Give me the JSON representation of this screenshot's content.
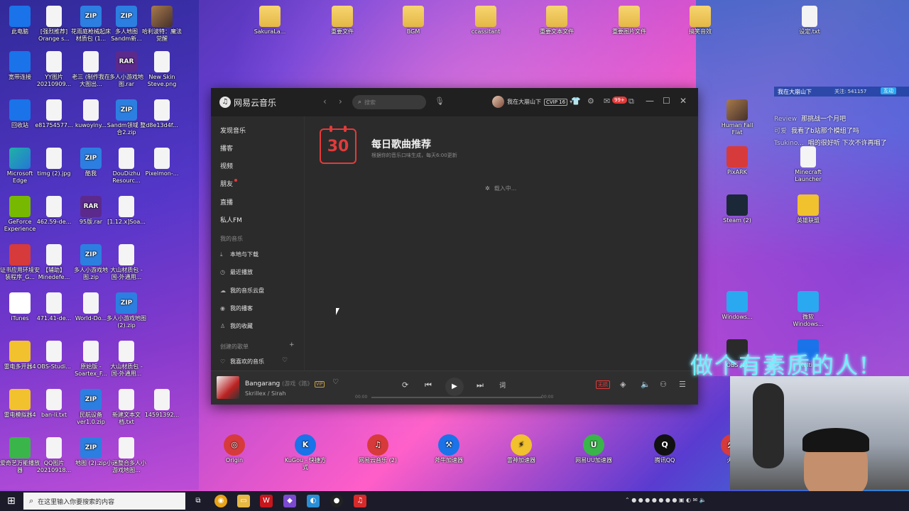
{
  "desktop": {
    "top_row": [
      {
        "label": "此电脑",
        "icon": "computer-icon",
        "cls": "g-blue"
      },
      {
        "label": "[强烈推荐] Orange s...",
        "icon": "file-icon",
        "cls": "g-file"
      },
      {
        "label": "花雨庭枪械起床材质包 (1...",
        "icon": "zip-icon",
        "cls": "g-zip"
      },
      {
        "label": "多人地图 Sandm新...",
        "icon": "zip-icon",
        "cls": "g-zip"
      },
      {
        "label": "哈利波特：魔法觉醒",
        "icon": "game-icon",
        "cls": "g-img"
      },
      {
        "label": "SakuraLa...",
        "icon": "folder-icon",
        "cls": "g-folder"
      },
      {
        "label": "重要文件",
        "icon": "folder-icon",
        "cls": "g-folder"
      },
      {
        "label": "BGM",
        "icon": "folder-icon",
        "cls": "g-folder"
      },
      {
        "label": "ccassitant",
        "icon": "folder-icon",
        "cls": "g-folder"
      },
      {
        "label": "重要文本文件",
        "icon": "folder-icon",
        "cls": "g-folder"
      },
      {
        "label": "重要图片文件",
        "icon": "folder-icon",
        "cls": "g-folder"
      },
      {
        "label": "搞笑音效",
        "icon": "folder-icon",
        "cls": "g-folder"
      },
      {
        "label": "设定.txt",
        "icon": "text-file-icon",
        "cls": "g-file"
      }
    ],
    "left_grid": [
      [
        "宽带连接",
        "YY图片 20210909...",
        "老三 (制作我在大图出...",
        "多人小游戏地图.rar",
        "New Skin Steve.png"
      ],
      [
        "回收站",
        "e81754577...",
        "kuwoyiny...",
        "Sandm领域 整合2.zip",
        "d8e13d4f..."
      ],
      [
        "Microsoft Edge",
        "timg (2).jpg",
        "酷我",
        "DouDizhu Resourc...",
        "Pixelmon-..."
      ],
      [
        "GeForce Experience",
        "462.59-de...",
        "95版.rar",
        "[1.12.x]Soa..."
      ],
      [
        "证书应用环境安装程序_G...",
        "【辅助】Minedefe...",
        "多人小游戏地图.zip",
        "大山材质包 - 国-外通用..."
      ],
      [
        "iTunes",
        "471.41-de...",
        "World-Do...",
        "多人小游戏地图 (2).zip"
      ],
      [
        "雷电多开器4",
        "OBS-Studi...",
        "原始版 - Soartex_F...",
        "大山材质包 - 国-外通用..."
      ],
      [
        "雷电模拟器4",
        "ban-li.txt",
        "民航设备 ver1.0.zip",
        "新建文本文档.txt",
        "14591392..."
      ],
      [
        "爱奇艺万能播放器",
        "QQ图片 20210918...",
        "地图 (2).zip",
        "小迷整合多人小游戏地图..."
      ]
    ],
    "right_col": [
      {
        "label": "Human Fall Flat",
        "cls": "g-img",
        "icon": "game-icon"
      },
      {
        "label": "PixARK",
        "cls": "g-red",
        "icon": "game-icon"
      },
      {
        "label": "Minecraft Launcher",
        "cls": "g-file",
        "icon": "file-icon"
      },
      {
        "label": "Steam (2)",
        "cls": "g-steam",
        "icon": "steam-icon"
      },
      {
        "label": "英雄联盟",
        "cls": "g-yellow",
        "icon": "game-icon"
      },
      {
        "label": "Windows...",
        "cls": "g-win",
        "icon": "windows-icon"
      },
      {
        "label": "微软 Windows...",
        "cls": "g-win",
        "icon": "windows-icon"
      },
      {
        "label": "OBS (2)",
        "cls": "g-app",
        "icon": "obs-icon"
      },
      {
        "label": "Multi...",
        "cls": "g-blue",
        "icon": "app-icon"
      }
    ],
    "dock": [
      {
        "label": "Origin",
        "cls": "g-red",
        "glyph": "◎"
      },
      {
        "label": "KuGou - 快捷方式",
        "cls": "g-blue",
        "glyph": "K"
      },
      {
        "label": "网易云音乐 (2)",
        "cls": "g-red",
        "glyph": "♫"
      },
      {
        "label": "斧牛加速器",
        "cls": "g-blue",
        "glyph": "⚒"
      },
      {
        "label": "雷神加速器",
        "cls": "g-yellow",
        "glyph": "⚡"
      },
      {
        "label": "网易UU加速器",
        "cls": "g-green",
        "glyph": "U"
      },
      {
        "label": "腾讯QQ",
        "cls": "g-qq",
        "glyph": "Q"
      },
      {
        "label": "火..",
        "cls": "g-red",
        "glyph": "火"
      }
    ]
  },
  "app": {
    "name": "网易云音乐",
    "search_placeholder": "搜索",
    "user_name": "我在大崩山下",
    "vip": "CVIP 16",
    "mail_badge": "99+",
    "sidebar": {
      "items": [
        "发现音乐",
        "播客",
        "视频",
        "朋友",
        "直播",
        "私人FM"
      ],
      "my_music_header": "我的音乐",
      "my_music": [
        "本地与下载",
        "最近播放",
        "我的音乐云盘",
        "我的播客",
        "我的收藏"
      ],
      "created_header": "创建的歌单",
      "liked": "我喜欢的音乐"
    },
    "daily": {
      "date_num": "30",
      "title": "每日歌曲推荐",
      "subtitle": "根据你的音乐口味生成，每天6:00更新",
      "loading": "载入中..."
    },
    "player": {
      "song": "Bangarang",
      "song_extra": "(游戏《踏》",
      "vip_tag": "VIP",
      "artist": "Skrillex / Sirah",
      "time_current": "00:00",
      "time_total": "00:00",
      "quality": "无损",
      "progress": 0
    }
  },
  "stream": {
    "title": "我在大崩山下",
    "follow": "关注: 541157",
    "interact": "互动",
    "chat": [
      {
        "name": "Review",
        "text": "那挑战一个月吧"
      },
      {
        "name": "可爱",
        "text": "我看了b站那个模组了吗"
      },
      {
        "name": "Tsukino...",
        "text": "唱的很好听 下次不许再唱了"
      }
    ],
    "slogan": "做个有素质的人!"
  },
  "taskbar": {
    "search_placeholder": "在这里输入你要搜索的内容"
  }
}
